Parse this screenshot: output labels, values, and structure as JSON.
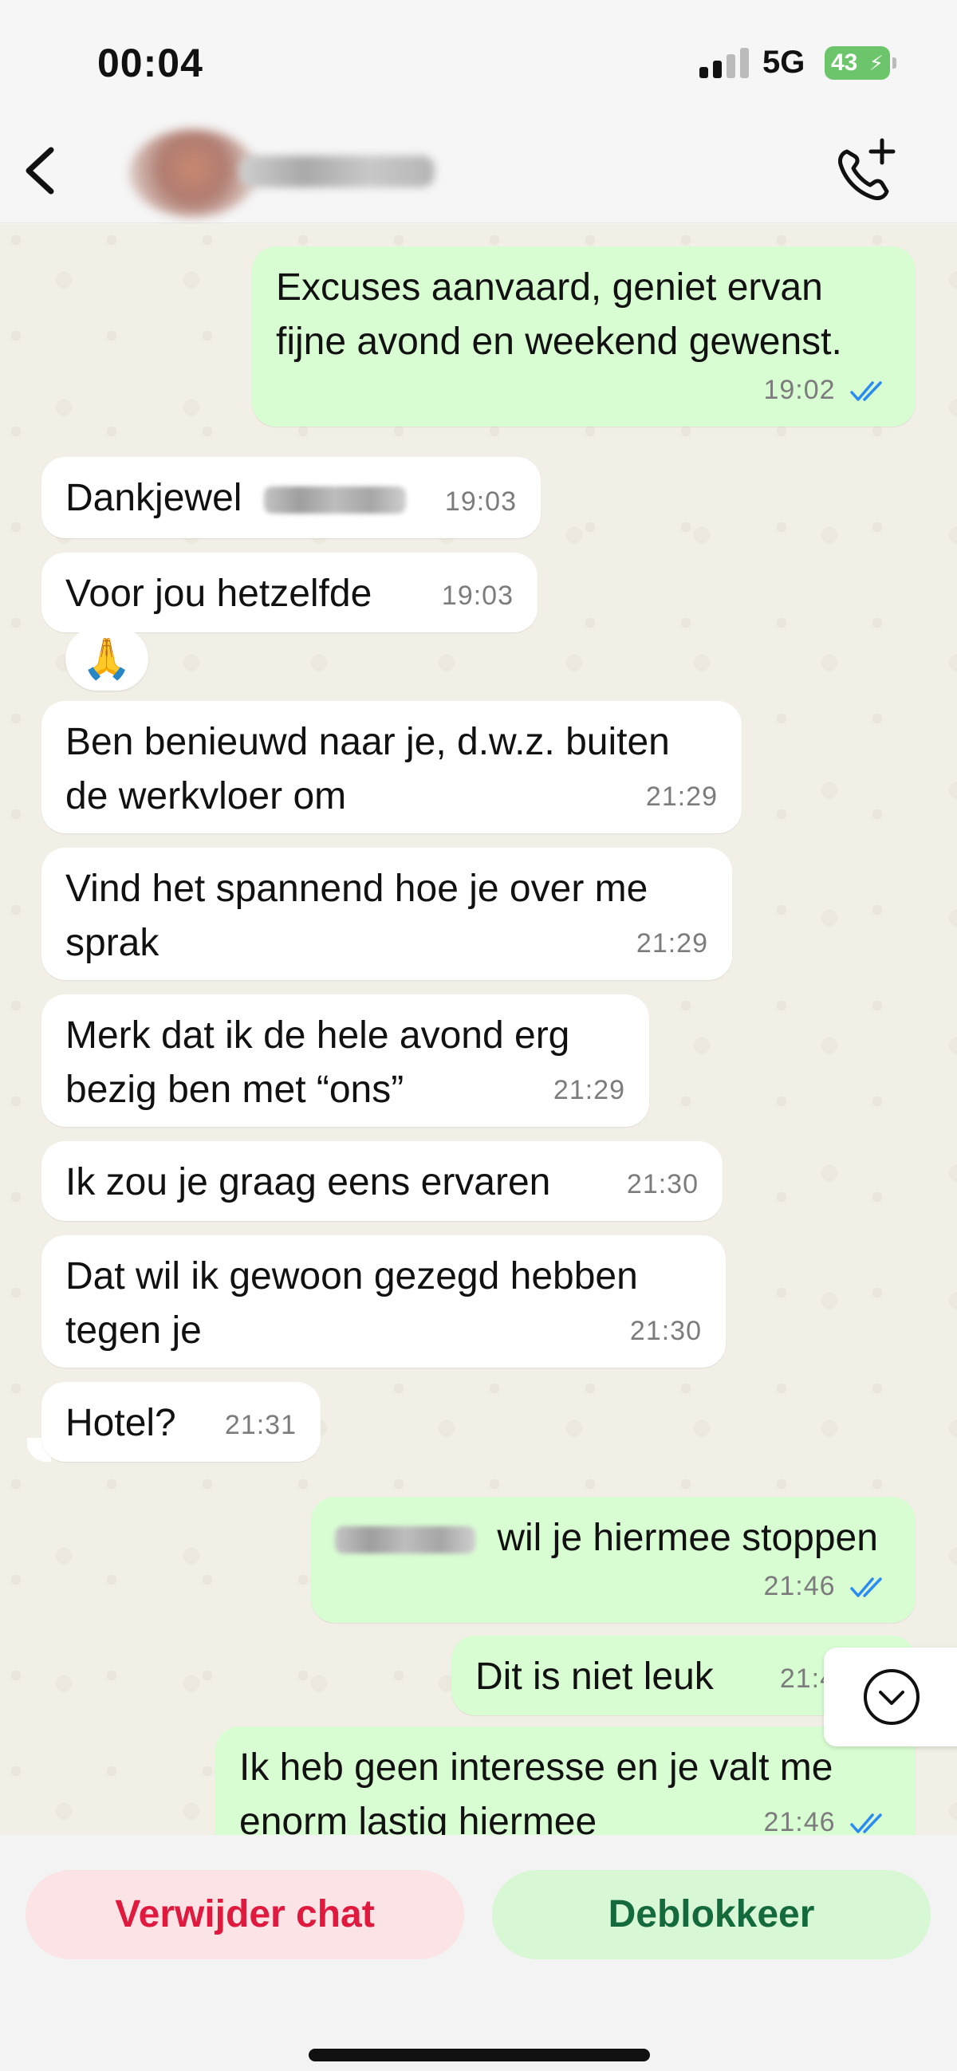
{
  "status_bar": {
    "time": "00:04",
    "network": "5G",
    "battery": "43"
  },
  "header": {
    "back_icon": "chevron-left-icon",
    "call_icon": "phone-plus-icon"
  },
  "messages": [
    {
      "direction": "out",
      "lines": [
        "Excuses aanvaard, geniet ervan",
        "fijne avond en weekend gewenst."
      ],
      "time": "19:02",
      "read": true
    },
    {
      "direction": "in",
      "text": "Dankjewel",
      "time": "19:03",
      "redacted_name": true
    },
    {
      "direction": "in",
      "text": "Voor jou hetzelfde",
      "time": "19:03",
      "reaction": "🙏"
    },
    {
      "direction": "in",
      "lines": [
        "Ben benieuwd naar je, d.w.z. buiten",
        "de werkvloer om"
      ],
      "time": "21:29"
    },
    {
      "direction": "in",
      "lines": [
        "Vind het spannend hoe je over me",
        "sprak"
      ],
      "time": "21:29"
    },
    {
      "direction": "in",
      "lines": [
        "Merk dat ik de hele avond erg",
        "bezig ben met “ons”"
      ],
      "time": "21:29"
    },
    {
      "direction": "in",
      "text": "Ik zou je graag eens ervaren",
      "time": "21:30"
    },
    {
      "direction": "in",
      "lines": [
        "Dat wil ik gewoon gezegd hebben",
        "tegen je"
      ],
      "time": "21:30"
    },
    {
      "direction": "in",
      "text": "Hotel?",
      "time": "21:31"
    },
    {
      "direction": "out",
      "text": "wil je hiermee stoppen",
      "time": "21:46",
      "read": true,
      "redacted_name": true
    },
    {
      "direction": "out",
      "text": "Dit is niet leuk",
      "time": "21:4"
    },
    {
      "direction": "out",
      "lines": [
        "Ik heb geen interesse en je valt me",
        "enorm lastig hiermee"
      ],
      "time": "21:46",
      "read": true
    }
  ],
  "actions": {
    "delete_chat": "Verwijder chat",
    "unblock": "Deblokkeer"
  },
  "colors": {
    "outgoing_bubble": "#d9fdd3",
    "incoming_bubble": "#ffffff",
    "read_ticks": "#2a8bf2",
    "delete_text": "#e0193e",
    "unblock_text": "#146a3c"
  }
}
